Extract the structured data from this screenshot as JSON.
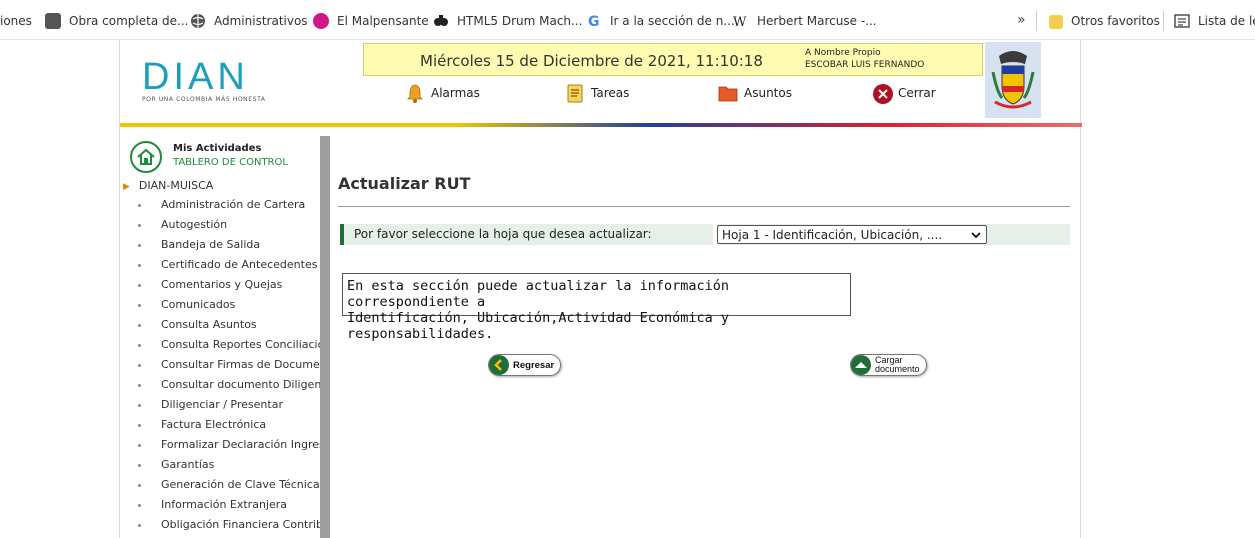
{
  "bookmarks": [
    {
      "label": "iones"
    },
    {
      "label": "Obra completa de..."
    },
    {
      "label": "Administrativos"
    },
    {
      "label": "El Malpensante"
    },
    {
      "label": "HTML5 Drum Mach..."
    },
    {
      "label": "Ir a la sección de n..."
    },
    {
      "label": "Herbert Marcuse -..."
    },
    {
      "label": "Otros favoritos"
    },
    {
      "label": "Lista de lec"
    }
  ],
  "header": {
    "logo_text": "DIAN",
    "logo_tagline": "POR UNA COLOMBIA MÁS HONESTA",
    "date": "Miércoles 15 de Diciembre de 2021, 11:10:18",
    "nombre_label": "A Nombre Propio",
    "nombre_value": "ESCOBAR LUIS FERNANDO",
    "nav": [
      {
        "label": "Alarmas"
      },
      {
        "label": "Tareas"
      },
      {
        "label": "Asuntos"
      },
      {
        "label": "Cerrar"
      }
    ]
  },
  "sidebar": {
    "title": "Mis Actividades",
    "subtitle": "TABLERO DE CONTROL",
    "root": "DIAN-MUISCA",
    "items": [
      {
        "label": "Administración de Cartera"
      },
      {
        "label": "Autogestión"
      },
      {
        "label": "Bandeja de Salida"
      },
      {
        "label": "Certificado de Antecedentes Adu"
      },
      {
        "label": "Comentarios y Quejas"
      },
      {
        "label": "Comunicados"
      },
      {
        "label": "Consulta Asuntos"
      },
      {
        "label": "Consulta Reportes Conciliación F"
      },
      {
        "label": "Consultar Firmas de Documento"
      },
      {
        "label": "Consultar documento Diligenciad"
      },
      {
        "label": "Diligenciar / Presentar"
      },
      {
        "label": "Factura Electrónica"
      },
      {
        "label": "Formalizar Declaración Ingreso S"
      },
      {
        "label": "Garantías"
      },
      {
        "label": "Generación de Clave Técnica"
      },
      {
        "label": "Información Extranjera"
      },
      {
        "label": "Obligación Financiera Contribuye"
      }
    ]
  },
  "main": {
    "title": "Actualizar RUT",
    "question": "Por favor seleccione la hoja que desea actualizar:",
    "select_value": "Hoja 1 - Identificación, Ubicación, ....",
    "info_line1": "En esta sección puede actualizar la información correspondiente a",
    "info_line2": "Identificación, Ubicación,Actividad Económica y responsabilidades.",
    "back_label": "Regresar",
    "upload_label1": "Cargar",
    "upload_label2": "documento"
  }
}
